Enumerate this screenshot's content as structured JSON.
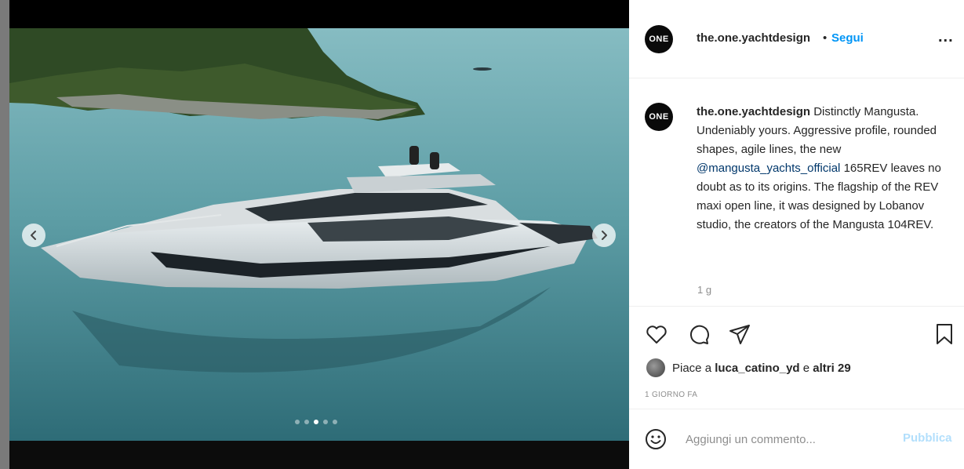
{
  "post": {
    "username": "the.one.yachtdesign",
    "separator": "•",
    "follow_label": "Segui",
    "more_label": "...",
    "avatar_text": "ONE"
  },
  "carousel": {
    "dot_count": 5,
    "active_dot": 2
  },
  "caption": {
    "username": "the.one.yachtdesign",
    "text_part1": "Distinctly Mangusta. Undeniably yours. Aggressive profile, rounded shapes, agile lines, the new",
    "mention": "@mangusta_yachts_official",
    "text_part2": "165REV leaves no doubt as to its origins. The flagship of the REV maxi open line, it was designed by Lobanov studio, the creators of the Mangusta 104REV.",
    "time": "1 g"
  },
  "likes": {
    "prefix": "Piace a",
    "user": "luca_catino_yd",
    "joiner": "e",
    "others": "altri 29"
  },
  "date_label": "1 GIORNO FA",
  "comment": {
    "placeholder": "Aggiungi un commento...",
    "publish_label": "Pubblica"
  },
  "icons": {
    "like": "heart-icon",
    "comment": "comment-bubble-icon",
    "share": "paper-plane-icon",
    "save": "bookmark-icon",
    "emoji": "emoji-smile-icon",
    "prev": "chevron-left-icon",
    "next": "chevron-right-icon"
  },
  "colors": {
    "follow": "#0095f6",
    "mention": "#00376b",
    "publish_disabled": "#b2dffc",
    "muted": "#8e8e8e"
  }
}
